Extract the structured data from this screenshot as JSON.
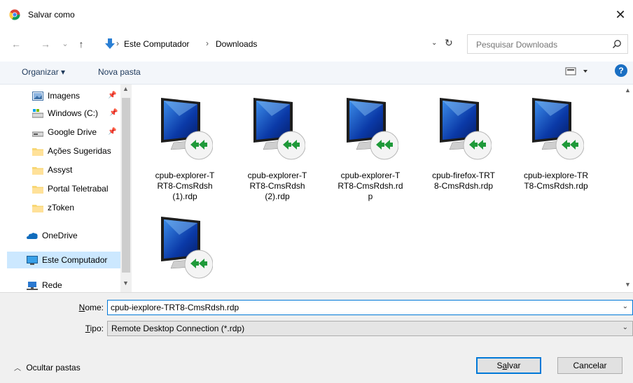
{
  "window": {
    "title": "Salvar como",
    "close": "✕"
  },
  "nav": {
    "back": "←",
    "forward": "→",
    "recent": "⌄",
    "up": "↑",
    "breadcrumb": [
      "Este Computador",
      "Downloads"
    ],
    "separator": "›",
    "search_placeholder": "Pesquisar Downloads"
  },
  "toolbar": {
    "organize": "Organizar ▾",
    "new_folder": "Nova pasta",
    "help": "?"
  },
  "sidebar": {
    "items": [
      {
        "label": "Imagens",
        "icon": "pictures-folder-icon",
        "pinned": true
      },
      {
        "label": "Windows (C:)",
        "icon": "drive-icon",
        "pinned": true
      },
      {
        "label": "Google Drive",
        "icon": "drive-icon",
        "pinned": true
      },
      {
        "label": "Ações Sugeridas",
        "icon": "folder-icon",
        "pinned": false
      },
      {
        "label": "Assyst",
        "icon": "folder-icon",
        "pinned": false
      },
      {
        "label": "Portal Teletrabal",
        "icon": "folder-icon",
        "pinned": false
      },
      {
        "label": "zToken",
        "icon": "folder-icon",
        "pinned": false
      },
      {
        "label": "OneDrive",
        "icon": "onedrive-icon",
        "pinned": false
      },
      {
        "label": "Este Computador",
        "icon": "computer-icon",
        "pinned": false,
        "selected": true
      },
      {
        "label": "Rede",
        "icon": "network-icon",
        "pinned": false
      }
    ]
  },
  "files": [
    {
      "name": "cpub-explorer-TRT8-CmsRdsh (1).rdp",
      "lines": [
        "cpub-explorer-T",
        "RT8-CmsRdsh",
        "(1).rdp"
      ]
    },
    {
      "name": "cpub-explorer-TRT8-CmsRdsh (2).rdp",
      "lines": [
        "cpub-explorer-T",
        "RT8-CmsRdsh",
        "(2).rdp"
      ]
    },
    {
      "name": "cpub-explorer-TRT8-CmsRdsh.rdp",
      "lines": [
        "cpub-explorer-T",
        "RT8-CmsRdsh.rd",
        "p"
      ]
    },
    {
      "name": "cpub-firefox-TRT8-CmsRdsh.rdp",
      "lines": [
        "cpub-firefox-TRT",
        "8-CmsRdsh.rdp"
      ]
    },
    {
      "name": "cpub-iexplore-TRT8-CmsRdsh.rdp",
      "lines": [
        "cpub-iexplore-TR",
        "T8-CmsRdsh.rdp"
      ]
    },
    {
      "name": "",
      "lines": []
    }
  ],
  "form": {
    "name_label": "Nome:",
    "name_value": "cpub-iexplore-TRT8-CmsRdsh.rdp",
    "type_label": "Tipo:",
    "type_value": "Remote Desktop Connection (*.rdp)"
  },
  "footer": {
    "hide_folders": "Ocultar pastas",
    "save": "Salvar",
    "cancel": "Cancelar"
  },
  "colors": {
    "accent": "#0078d7",
    "selected": "#cce8ff",
    "toolbar_bg": "#f3f6fa"
  }
}
